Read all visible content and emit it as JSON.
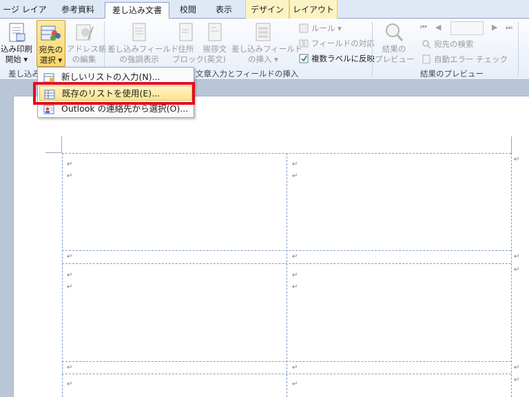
{
  "tabs": [
    {
      "label": "ージ レイアウト"
    },
    {
      "label": "参考資料"
    },
    {
      "label": "差し込み文書"
    },
    {
      "label": "校閲"
    },
    {
      "label": "表示"
    },
    {
      "label": "デザイン"
    },
    {
      "label": "レイアウト"
    }
  ],
  "ribbon": {
    "start_merge": {
      "line1": "込み印刷",
      "line2": "開始 ▾"
    },
    "select_recipients": {
      "line1": "宛先の",
      "line2": "選択 ▾"
    },
    "edit_list": {
      "line1": "アドレス帳",
      "line2": "の編集"
    },
    "highlight_fields": {
      "line1": "差し込みフィールド",
      "line2": "の強調表示"
    },
    "address_block": {
      "line1": "住所",
      "line2": "ブロック"
    },
    "greeting": {
      "line1": "挨拶文",
      "line2": "(英文)"
    },
    "insert_field": {
      "line1": "差し込みフィールド",
      "line2": "の挿入 ▾"
    },
    "rules": "ルール ▾",
    "match_fields": "フィールドの対応",
    "update_labels": "複数ラベルに反映",
    "preview_results": {
      "line1": "結果の",
      "line2": "プレビュー"
    },
    "find_recipient": "宛先の検索",
    "auto_check": "自動エラー チェック",
    "group_start": "差し込み",
    "group_write": "文章入力とフィールドの挿入",
    "group_preview": "結果のプレビュー"
  },
  "menu": {
    "items": [
      {
        "label": "新しいリストの入力(N)..."
      },
      {
        "label": "既存のリストを使用(E)..."
      },
      {
        "label": "Outlook の連絡先から選択(O)..."
      }
    ]
  },
  "document": {
    "para_mark": "↵",
    "cell_end_mark": "↵"
  }
}
